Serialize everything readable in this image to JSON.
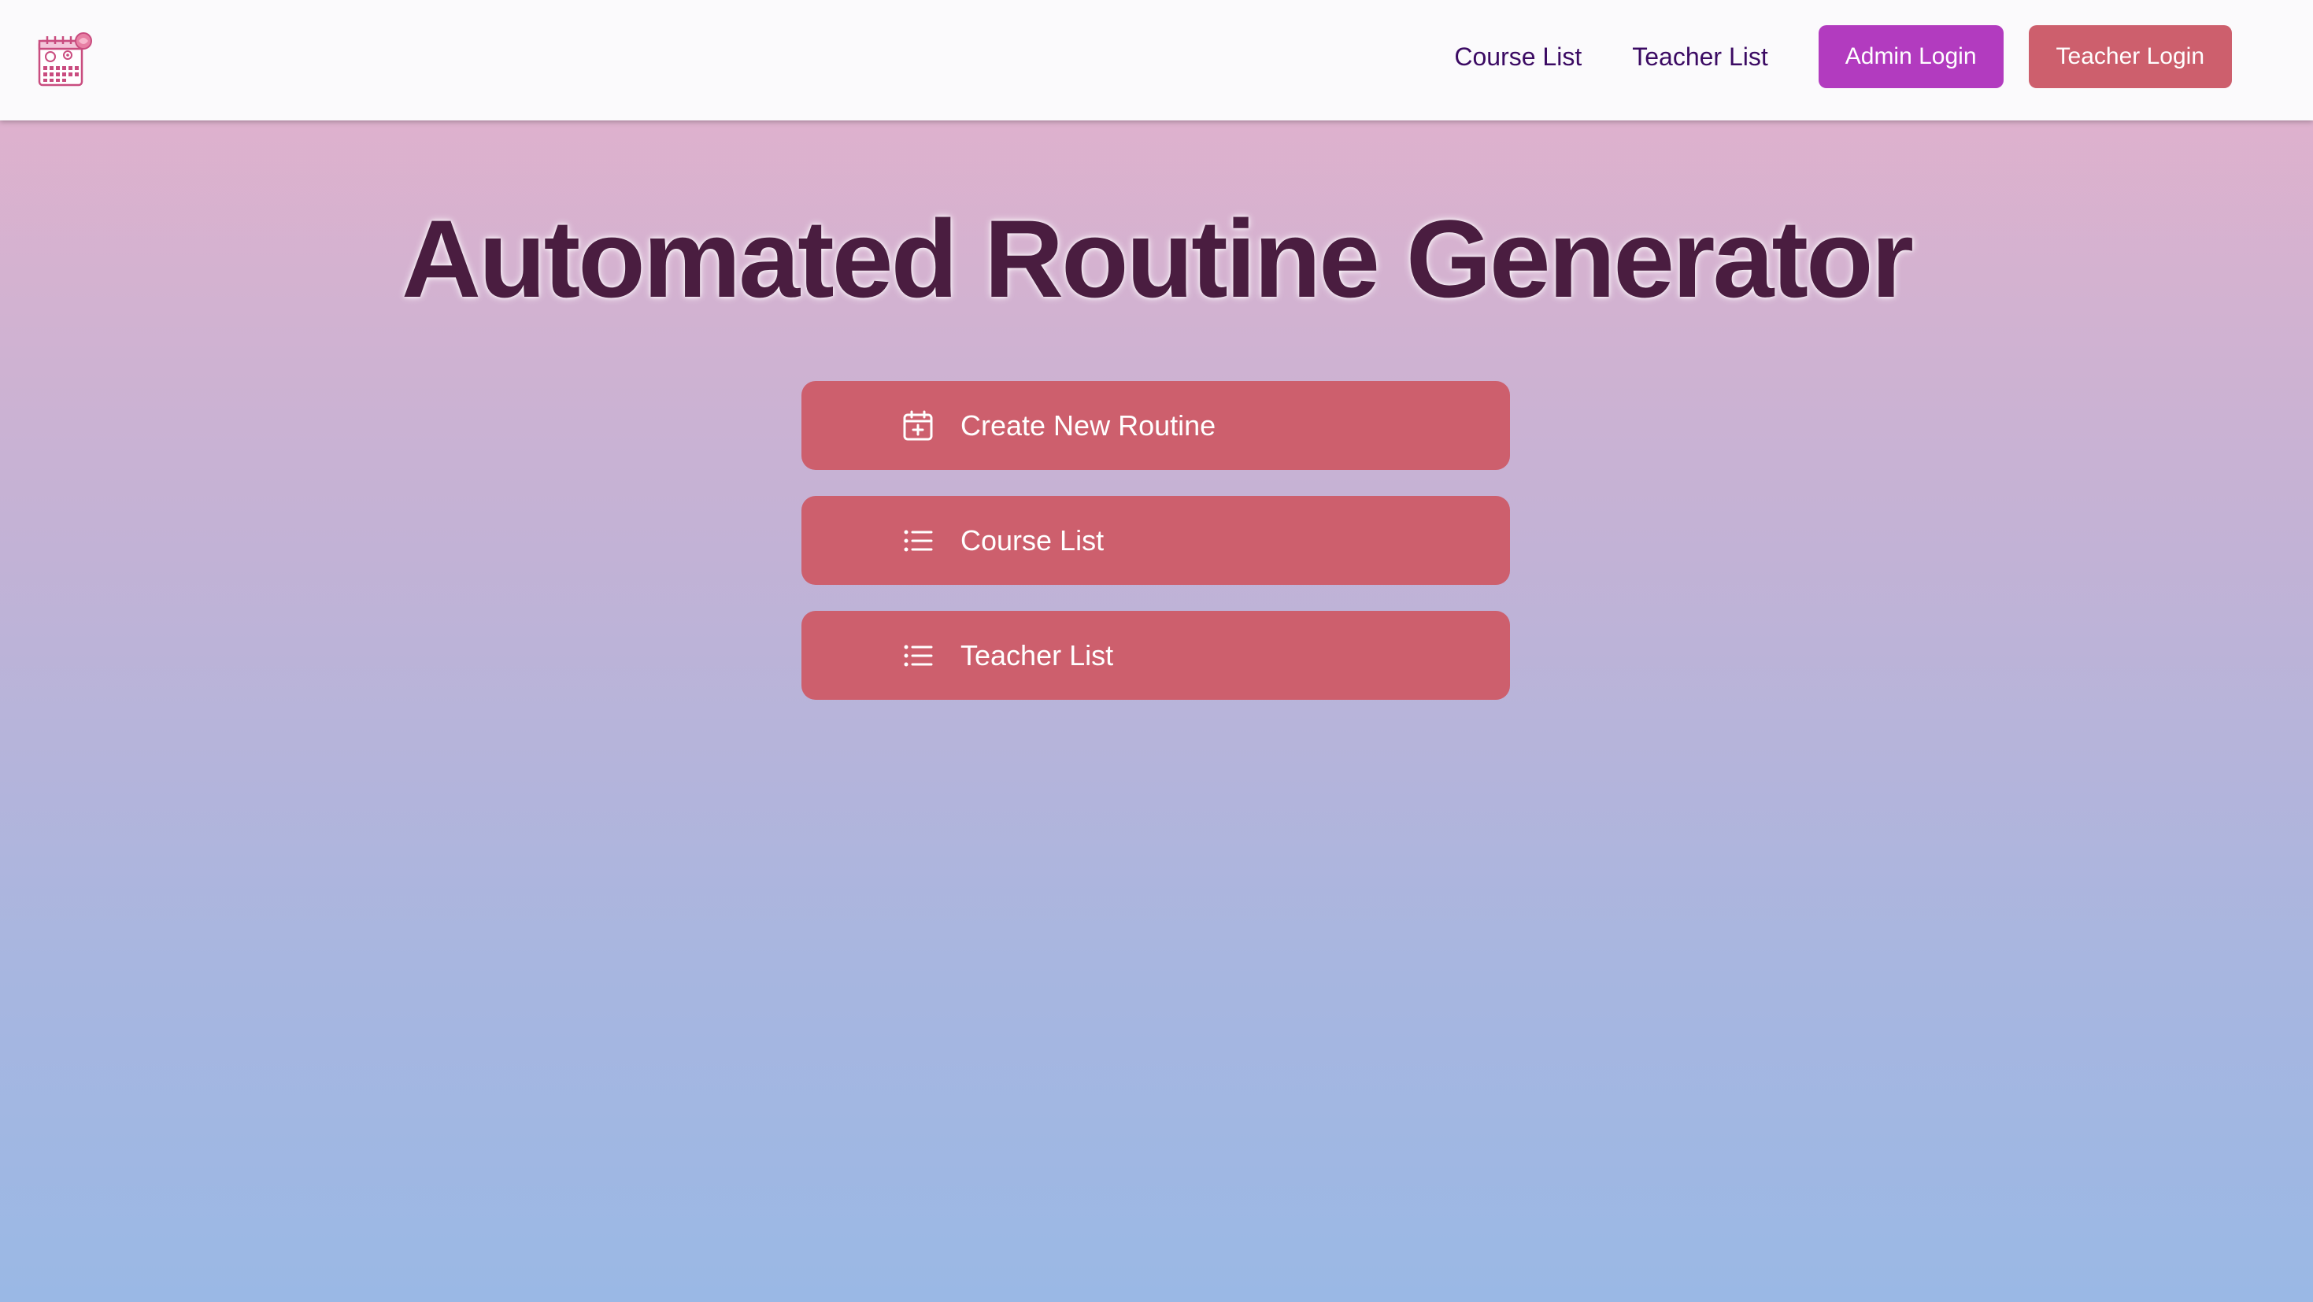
{
  "nav": {
    "logo_icon": "calendar-clock-logo-icon",
    "links": [
      "Course List",
      "Teacher List"
    ],
    "admin_login": "Admin Login",
    "teacher_login": "Teacher Login"
  },
  "hero": {
    "title": "Automated Routine Generator"
  },
  "menu": {
    "items": [
      {
        "label": "Create New Routine",
        "icon": "calendar-plus-icon"
      },
      {
        "label": "Course List",
        "icon": "list-icon"
      },
      {
        "label": "Teacher List",
        "icon": "list-icon"
      }
    ]
  },
  "colors": {
    "accent_red": "#cd5f6d",
    "accent_purple": "#b23bbf",
    "nav_link": "#3b0a63",
    "title": "#4a1d40"
  }
}
